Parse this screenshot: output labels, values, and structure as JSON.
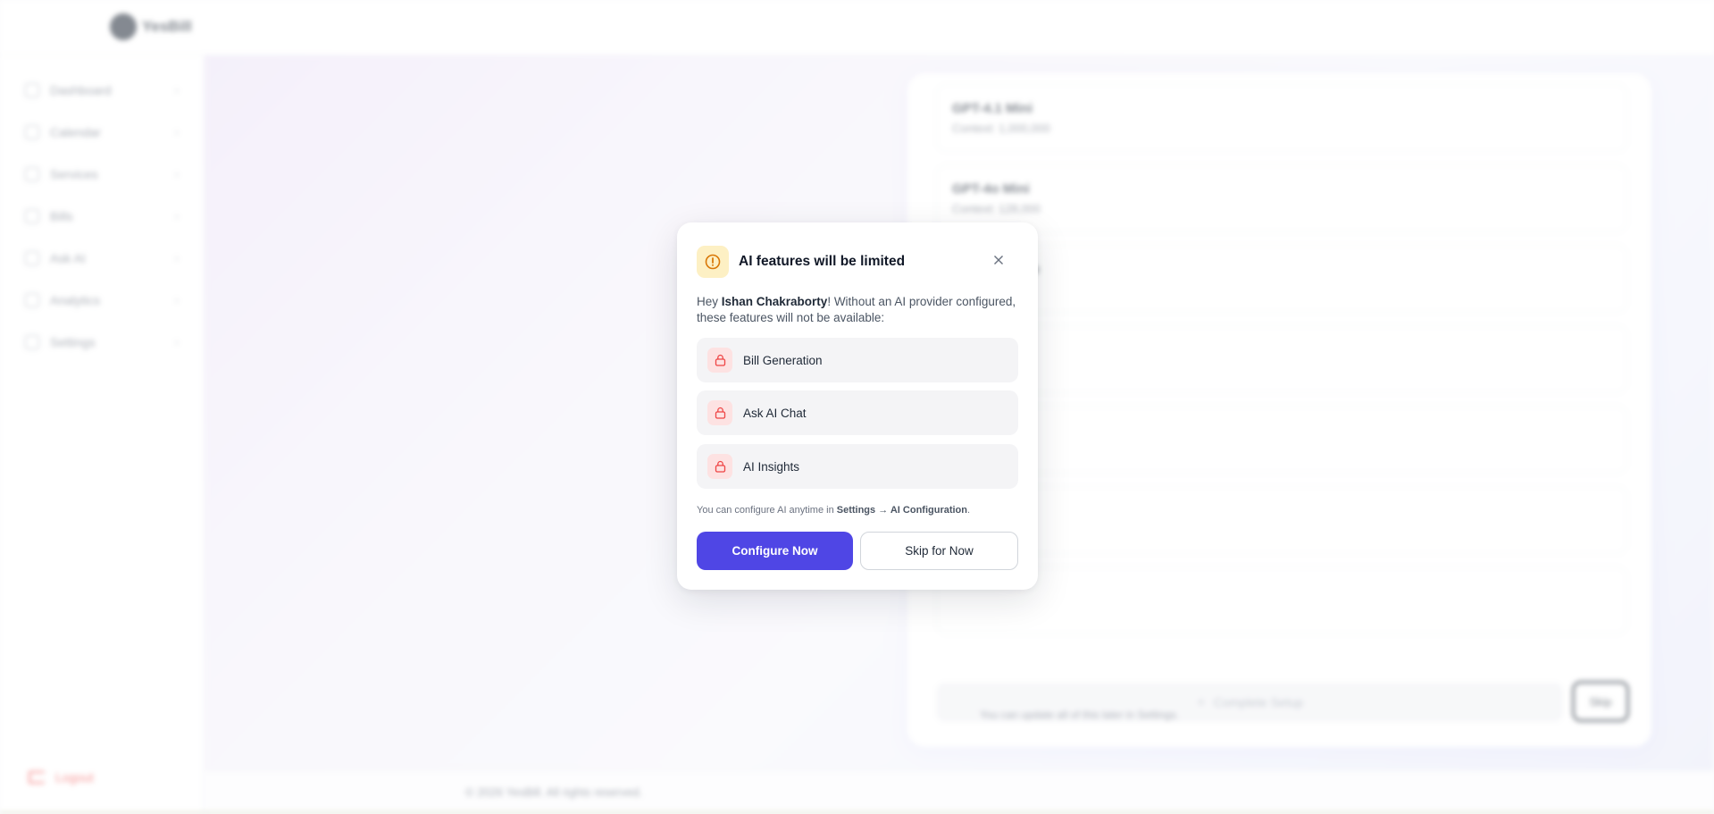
{
  "app": {
    "brand": "YesBill",
    "sidebar": {
      "items": [
        {
          "label": "Dashboard",
          "icon": "grid-icon"
        },
        {
          "label": "Calendar",
          "icon": "calendar-icon"
        },
        {
          "label": "Services",
          "icon": "services-icon"
        },
        {
          "label": "Bills",
          "icon": "receipt-icon"
        },
        {
          "label": "Ask AI",
          "icon": "chat-icon"
        },
        {
          "label": "Analytics",
          "icon": "chart-icon"
        },
        {
          "label": "Settings",
          "icon": "gear-icon"
        }
      ],
      "logout_label": "Logout"
    },
    "models": [
      {
        "name": "GPT-4.1 Mini",
        "context": "Context: 1,000,000"
      },
      {
        "name": "GPT-4o Mini",
        "context": "Context: 128,000"
      },
      {
        "name": "GPT-4.1 Nano",
        "context": ""
      },
      {
        "name": "",
        "context": ""
      },
      {
        "name": "",
        "context": ""
      },
      {
        "name": "",
        "context": ""
      },
      {
        "name": "",
        "context": ""
      }
    ],
    "complete_label": "Complete Setup",
    "skip_label": "Skip",
    "update_note": "You can update all of this later in Settings.",
    "footer": "© 2026 YesBill. All rights reserved."
  },
  "dialog": {
    "title": "AI features will be limited",
    "greeting": "Hey ",
    "user_name": "Ishan Chakraborty",
    "message_rest": "! Without an AI provider configured, these features will not be available:",
    "features": [
      {
        "label": "Bill Generation",
        "icon": "lock-icon"
      },
      {
        "label": "Ask AI Chat",
        "icon": "lock-icon"
      },
      {
        "label": "AI Insights",
        "icon": "lock-icon"
      }
    ],
    "hint_prefix": "You can configure AI anytime in ",
    "hint_path": "Settings → AI Configuration",
    "hint_suffix": ".",
    "primary_label": "Configure Now",
    "secondary_label": "Skip for Now",
    "colors": {
      "primary": "#4f46e5",
      "warning_bg": "#fdf0c4",
      "warning_fg": "#d97706",
      "lock_bg": "#fde2e2",
      "lock_fg": "#ef4444"
    }
  }
}
